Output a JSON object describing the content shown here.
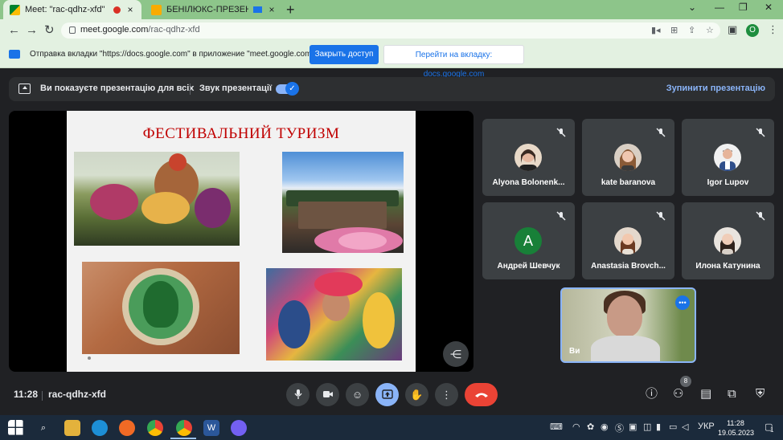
{
  "browser": {
    "tabs": [
      {
        "title": "Meet: \"rac-qdhz-xfd\"",
        "close": "×"
      },
      {
        "title": "БЕНІЛЮКС-ПРЕЗЕНТА.ppt -",
        "close": "×"
      }
    ],
    "new_tab": "+",
    "window_controls": [
      "⌄",
      "—",
      "❐",
      "✕"
    ],
    "url_host": "meet.google.com",
    "url_path": "/rac-qdhz-xfd",
    "profile_letter": "O"
  },
  "infobar": {
    "message": "Отправка вкладки \"https://docs.google.com\" в приложение \"meet.google.com\"...",
    "share_access": "Закрыть доступ",
    "switch_tab": "Перейти на вкладку: docs.google.com"
  },
  "presenting": {
    "status": "Ви показуєте презентацію для всіх",
    "sound_label": "Звук презентації",
    "sound_on": true,
    "stop": "Зупинити презентацію"
  },
  "slide": {
    "title": "ФЕСТИВАЛЬНИЙ ТУРИЗМ"
  },
  "participants": [
    {
      "name": "Alyona Bolonenk...",
      "muted": true
    },
    {
      "name": "kate baranova",
      "muted": true
    },
    {
      "name": "Igor Lupov",
      "muted": true
    },
    {
      "name": "Андрей Шевчук",
      "muted": true,
      "initial": "A"
    },
    {
      "name": "Anastasia Brovch...",
      "muted": true
    },
    {
      "name": "Илона Катунина",
      "muted": true
    }
  ],
  "self_tile": {
    "label": "Ви"
  },
  "controls": {
    "time": "11:28",
    "meeting_code": "rac-qdhz-xfd",
    "people_count": "8"
  },
  "taskbar": {
    "language": "УКР",
    "time": "11:28",
    "date": "19.05.2023",
    "notifications": "1"
  },
  "colors": {
    "accent": "#1a73e8",
    "end_call": "#ea4335",
    "tab_strip": "#8dc58a"
  }
}
